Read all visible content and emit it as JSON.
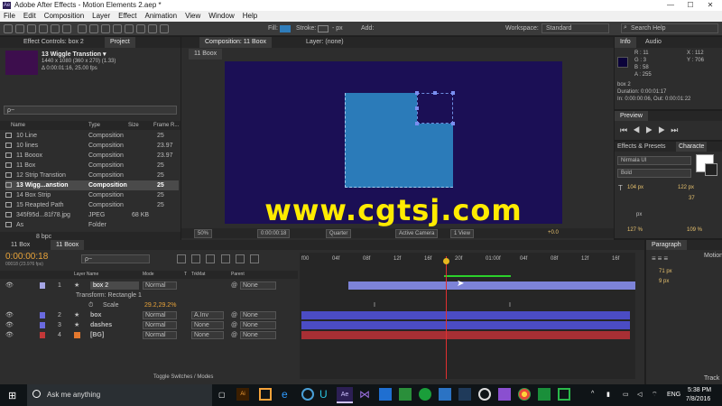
{
  "app": {
    "title": "Adobe After Effects - Motion Elements 2.aep *",
    "logo": "Ae",
    "window_controls": [
      "—",
      "☐",
      "✕"
    ]
  },
  "menu": [
    "File",
    "Edit",
    "Composition",
    "Layer",
    "Effect",
    "Animation",
    "View",
    "Window",
    "Help"
  ],
  "toolbar": {
    "fill_label": "Fill:",
    "stroke_label": "Stroke:",
    "stroke_px": "- px",
    "add_label": "Add:",
    "workspace_label": "Workspace:",
    "workspace_value": "Standard",
    "search_placeholder": "Search Help",
    "fill_color": "#2f7dbb",
    "stroke_color": "#444444"
  },
  "project_panel": {
    "tab_effects": "Effect Controls: box 2",
    "tab_project": "Project",
    "selected_name": "13 Wiggle Transtion ▾",
    "selected_size": "1440 x 1080 (360 x 270) (1.33)",
    "selected_duration": "Δ 0:00:01:16, 25.00 fps",
    "search_placeholder": "ρ~",
    "col_name": "Name",
    "col_type": "Type",
    "col_size": "Size",
    "col_fps": "Frame R...",
    "items": [
      {
        "name": "10 Line",
        "type": "Composition",
        "size": "",
        "fps": "25"
      },
      {
        "name": "10 lines",
        "type": "Composition",
        "size": "",
        "fps": "23.97"
      },
      {
        "name": "11 Booox",
        "type": "Composition",
        "size": "",
        "fps": "23.97"
      },
      {
        "name": "11 Box",
        "type": "Composition",
        "size": "",
        "fps": "25"
      },
      {
        "name": "12 Strip Transtion",
        "type": "Composition",
        "size": "",
        "fps": "25"
      },
      {
        "name": "13 Wigg...anstion",
        "type": "Composition",
        "size": "",
        "fps": "25"
      },
      {
        "name": "14 Box Strip",
        "type": "Composition",
        "size": "",
        "fps": "25"
      },
      {
        "name": "15 Reapted Path",
        "type": "Composition",
        "size": "",
        "fps": "25"
      },
      {
        "name": "345f95d...81f78.jpg",
        "type": "JPEG",
        "size": "68 KB",
        "fps": ""
      },
      {
        "name": "As",
        "type": "Folder",
        "size": "",
        "fps": ""
      }
    ],
    "bpc": "8 bpc"
  },
  "comp_panel": {
    "tab_comp": "Composition: 11 Boox",
    "tab_layer": "Layer: (none)",
    "sub_tab": "11 Boox",
    "zoom": "50%",
    "timecode": "0:00:00:18",
    "resolution": "Quarter",
    "camera": "Active Camera",
    "view": "1 View",
    "exposure": "+0.0",
    "bg_color": "#1b0f55",
    "box_color": "#2b7bb9",
    "watermark": "www.cgtsj.com"
  },
  "info_panel": {
    "tab_info": "Info",
    "tab_audio": "Audio",
    "r": "R : 11",
    "g": "G : 3",
    "b": "B : 58",
    "a": "A : 255",
    "x": "X : 112",
    "y": "Y : 706",
    "layer": "box 2",
    "duration": "Duration: 0:00:01:17",
    "in_out": "In: 0:00:00:06, Out: 0:00:01:22",
    "swatch": "#0b033a"
  },
  "preview_panel": {
    "title": "Preview"
  },
  "character_panel": {
    "tab_effects": "Effects & Presets",
    "tab_char": "Characte",
    "font": "Nirmala UI",
    "style": "Bold",
    "size": "104 px",
    "leading": "122 px",
    "tracking": "37",
    "unit": "px",
    "vscale": "127 %",
    "hscale": "109 %"
  },
  "paragraph_panel": {
    "title": "Paragraph",
    "motion_tab": "Motion",
    "indent1": "71 px",
    "indent2": "9 px",
    "tracker_tab": "Track"
  },
  "timeline": {
    "tab1": "11 Box",
    "tab2": "11 Boox",
    "timecode": "0:00:00:18",
    "fps": "00018 (23.976 fps)",
    "search_placeholder": "ρ~",
    "col_name": "Layer Name",
    "col_mode": "Mode",
    "col_t": "T",
    "col_trkmat": "TrkMat",
    "col_parent": "Parent",
    "ruler": [
      "f00",
      "04f",
      "08f",
      "12f",
      "16f",
      "20f",
      "01:00f",
      "04f",
      "08f",
      "12f",
      "16f"
    ],
    "layers": [
      {
        "num": "1",
        "name": "box 2",
        "mode": "Normal",
        "trkmat": "",
        "parent": "None",
        "color": "#a6a6e6"
      },
      {
        "num": "2",
        "name": "box",
        "mode": "Normal",
        "trkmat": "A.Inv",
        "parent": "None",
        "color": "#6a6adf"
      },
      {
        "num": "3",
        "name": "dashes",
        "mode": "Normal",
        "trkmat": "None",
        "parent": "None",
        "color": "#6a6adf"
      },
      {
        "num": "4",
        "name": "[BG]",
        "mode": "Normal",
        "trkmat": "None",
        "parent": "None",
        "color": "#c33838"
      }
    ],
    "transform_label": "Transform: Rectangle 1",
    "scale_label": "Scale",
    "scale_value": "29.2,29.2%",
    "toggle_label": "Toggle Switches / Modes"
  },
  "taskbar": {
    "search_placeholder": "Ask me anything",
    "lang": "ENG",
    "time": "5:38 PM",
    "date": "7/8/2016"
  }
}
